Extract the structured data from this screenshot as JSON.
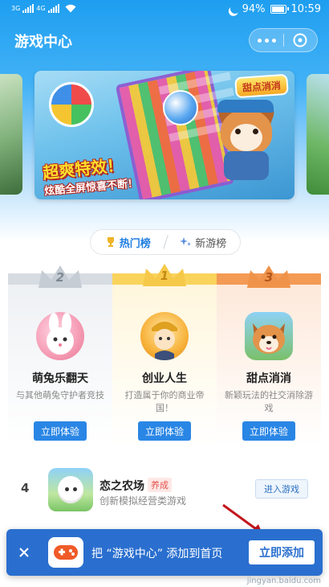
{
  "status_bar": {
    "signal_1": "3G",
    "signal_2": "4G",
    "battery": "94%",
    "time": "10:59"
  },
  "nav": {
    "title": "游戏中心"
  },
  "banner": {
    "logo_text": "甜点消消",
    "slogan_1": "超爽特效！",
    "slogan_2": "炫酷全屏惊喜不断！"
  },
  "rank_tabs": [
    {
      "label": "热门榜",
      "active": true
    },
    {
      "label": "新游榜",
      "active": false
    }
  ],
  "podium": [
    {
      "rank": "2",
      "name": "萌兔乐翻天",
      "desc": "与其他萌兔守护者竞技",
      "button": "立即体验"
    },
    {
      "rank": "1",
      "name": "创业人生",
      "desc": "打造属于你的商业帝国！",
      "button": "立即体验"
    },
    {
      "rank": "3",
      "name": "甜点消消",
      "desc": "新颖玩法的社交消除游戏",
      "button": "立即体验"
    }
  ],
  "list": [
    {
      "rank": "4",
      "name": "恋之农场",
      "tag": "养成",
      "desc": "创新模拟经营类游戏",
      "button": "进入游戏"
    }
  ],
  "add_bar": {
    "text": "把 “游戏中心” 添加到首页",
    "button": "立即添加"
  },
  "watermark": "jingyan.baidu.com",
  "colors": {
    "primary": "#2a86e5",
    "header_top": "#1e9ef0",
    "silver": "#bfc6cf",
    "gold": "#f7c94a",
    "bronze": "#f0934a",
    "tag_red": "#e6534e"
  }
}
